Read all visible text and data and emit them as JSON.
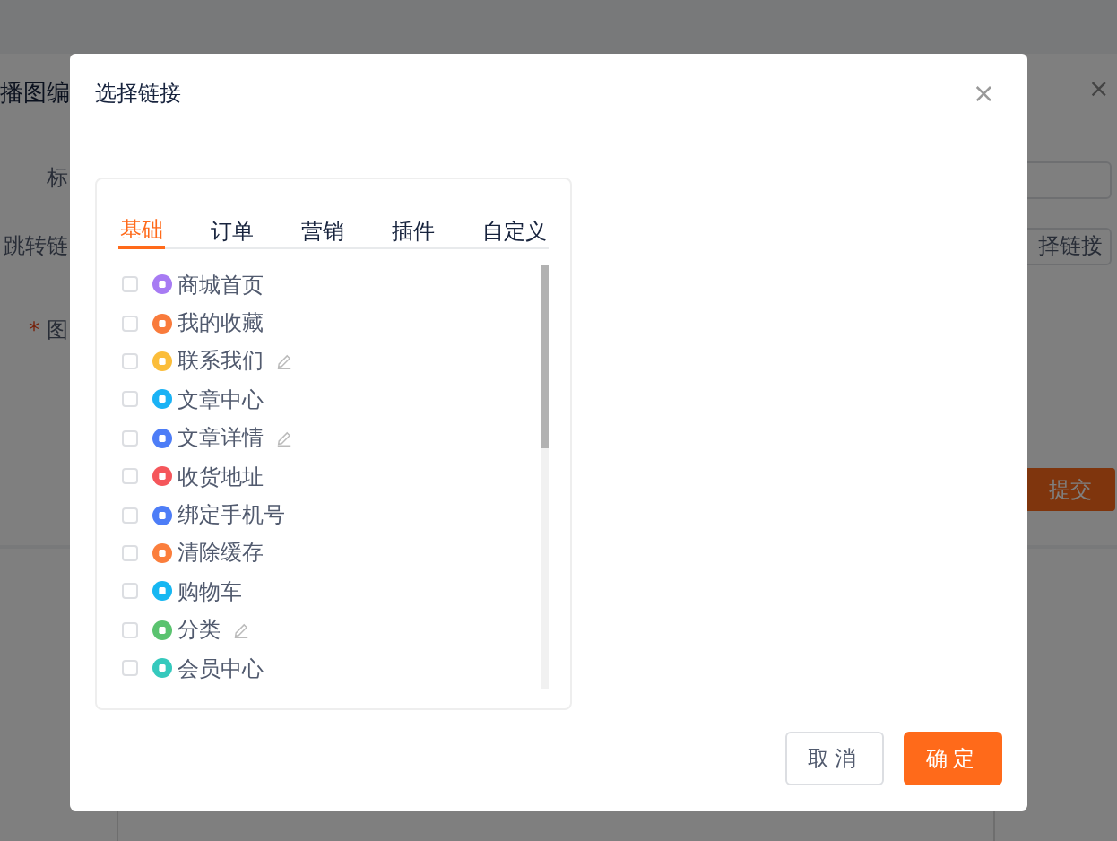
{
  "background": {
    "title": "播图编",
    "close": "×",
    "labels": [
      {
        "text": "标"
      },
      {
        "text": "跳转链"
      },
      {
        "text": "图",
        "required_mark": "*"
      }
    ],
    "link_button": "择链接",
    "submit_button": "提交"
  },
  "dialog": {
    "title": "选择链接",
    "close": "×",
    "tabs": [
      {
        "label": "基础",
        "selected": true
      },
      {
        "label": "订单",
        "selected": false
      },
      {
        "label": "营销",
        "selected": false
      },
      {
        "label": "插件",
        "selected": false
      },
      {
        "label": "自定义",
        "selected": false
      }
    ],
    "items": [
      {
        "label": "商城首页",
        "checked": false,
        "color": "#a77bf3",
        "editable": false
      },
      {
        "label": "我的收藏",
        "checked": false,
        "color": "#f97b3c",
        "editable": false
      },
      {
        "label": "联系我们",
        "checked": false,
        "color": "#fbbd3a",
        "editable": true
      },
      {
        "label": "文章中心",
        "checked": false,
        "color": "#1ab2f5",
        "editable": false
      },
      {
        "label": "文章详情",
        "checked": false,
        "color": "#4d7df7",
        "editable": true
      },
      {
        "label": "收货地址",
        "checked": false,
        "color": "#f5565b",
        "editable": false
      },
      {
        "label": "绑定手机号",
        "checked": false,
        "color": "#4d7df7",
        "editable": false
      },
      {
        "label": "清除缓存",
        "checked": false,
        "color": "#fb7e3c",
        "editable": false
      },
      {
        "label": "购物车",
        "checked": false,
        "color": "#16b7f2",
        "editable": false
      },
      {
        "label": "分类",
        "checked": false,
        "color": "#5ac36f",
        "editable": true
      },
      {
        "label": "会员中心",
        "checked": false,
        "color": "#35c9bd",
        "editable": false
      }
    ],
    "buttons": [
      {
        "label": "取消",
        "kind": "cancel"
      },
      {
        "label": "确定",
        "kind": "primary"
      }
    ]
  }
}
